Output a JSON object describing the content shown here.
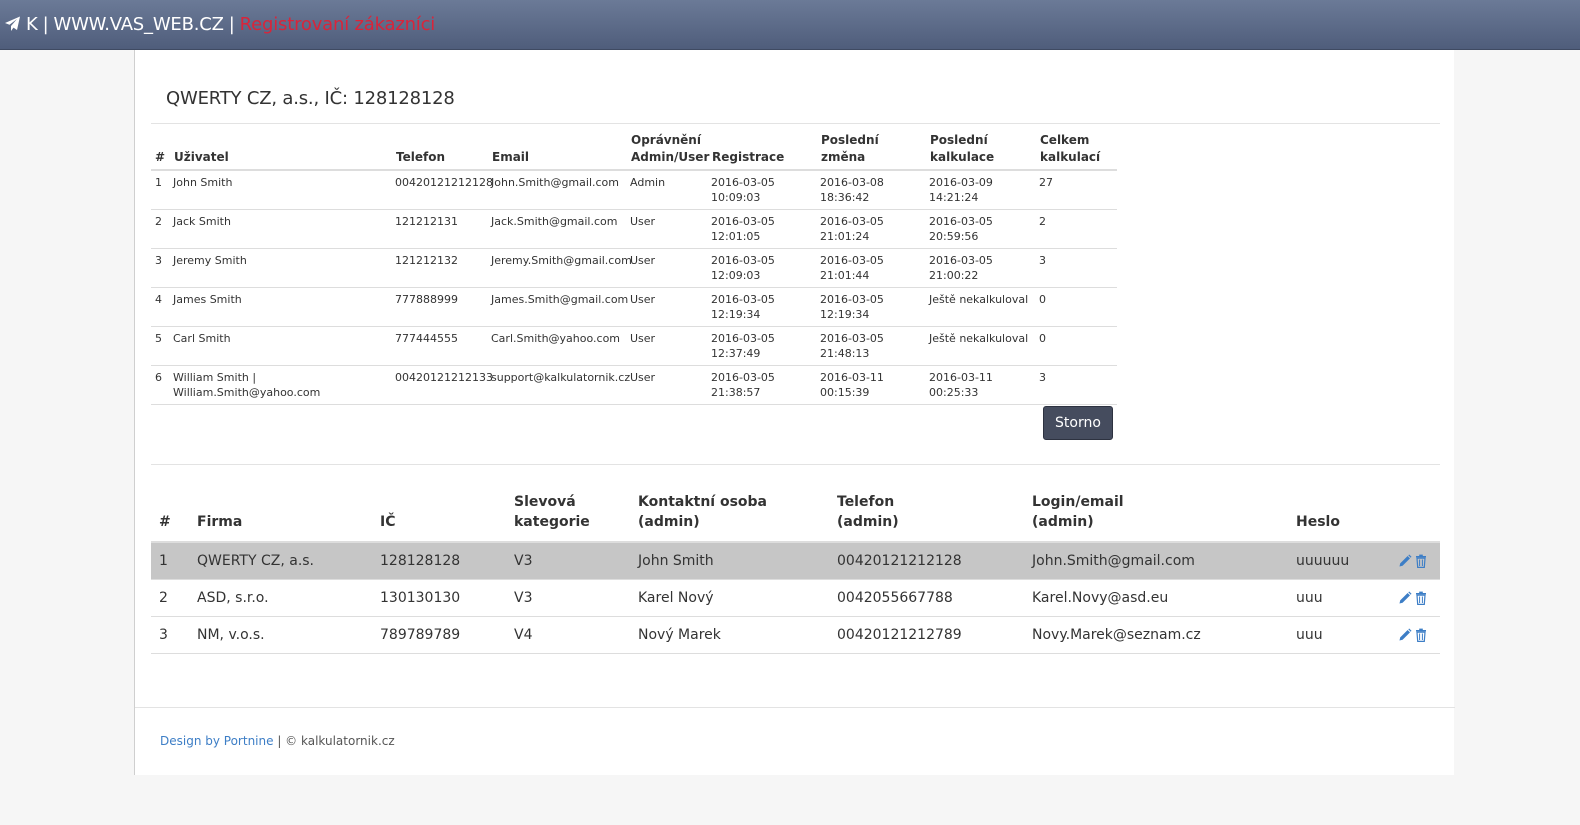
{
  "navbar": {
    "brand_k": "K",
    "sep": "|",
    "site": "WWW.VAS_WEB.CZ",
    "current_page": "Registrovaní zákazníci"
  },
  "company": {
    "title": "QWERTY CZ, a.s.,  IČ: 128128128"
  },
  "users_table": {
    "headers": {
      "num": "#",
      "user": "Uživatel",
      "phone": "Telefon",
      "email": "Email",
      "perm1": "Oprávnění",
      "perm2": "Admin/User",
      "reg": "Registrace",
      "change1": "Poslední",
      "change2": "změna",
      "calc1": "Poslední",
      "calc2": "kalkulace",
      "total1": "Celkem",
      "total2": "kalkulací"
    },
    "rows": [
      {
        "num": "1",
        "user": "John Smith",
        "user2": "",
        "phone": "00420121212128",
        "email": "John.Smith@gmail.com",
        "perm": "Admin",
        "reg_date": "2016-03-05",
        "reg_time": "10:09:03",
        "chg_date": "2016-03-08",
        "chg_time": "18:36:42",
        "calc_date": "2016-03-09",
        "calc_time": "14:21:24",
        "total": "27"
      },
      {
        "num": "2",
        "user": "Jack Smith",
        "user2": "",
        "phone": "121212131",
        "email": "Jack.Smith@gmail.com",
        "perm": "User",
        "reg_date": "2016-03-05",
        "reg_time": "12:01:05",
        "chg_date": "2016-03-05",
        "chg_time": "21:01:24",
        "calc_date": "2016-03-05",
        "calc_time": "20:59:56",
        "total": "2"
      },
      {
        "num": "3",
        "user": "Jeremy Smith",
        "user2": "",
        "phone": "121212132",
        "email": "Jeremy.Smith@gmail.com",
        "perm": "User",
        "reg_date": "2016-03-05",
        "reg_time": "12:09:03",
        "chg_date": "2016-03-05",
        "chg_time": "21:01:44",
        "calc_date": "2016-03-05",
        "calc_time": "21:00:22",
        "total": "3"
      },
      {
        "num": "4",
        "user": "James Smith",
        "user2": "",
        "phone": "777888999",
        "email": "James.Smith@gmail.com",
        "perm": "User",
        "reg_date": "2016-03-05",
        "reg_time": "12:19:34",
        "chg_date": "2016-03-05",
        "chg_time": "12:19:34",
        "calc_date": "Ještě nekalkuloval",
        "calc_time": "",
        "total": "0"
      },
      {
        "num": "5",
        "user": "Carl Smith",
        "user2": "",
        "phone": "777444555",
        "email": "Carl.Smith@yahoo.com",
        "perm": "User",
        "reg_date": "2016-03-05",
        "reg_time": "12:37:49",
        "chg_date": "2016-03-05",
        "chg_time": "21:48:13",
        "calc_date": "Ještě nekalkuloval",
        "calc_time": "",
        "total": "0"
      },
      {
        "num": "6",
        "user": "William Smith |",
        "user2": "William.Smith@yahoo.com",
        "phone": "00420121212133",
        "email": "support@kalkulatornik.cz",
        "perm": "User",
        "reg_date": "2016-03-05",
        "reg_time": "21:38:57",
        "chg_date": "2016-03-11",
        "chg_time": "00:15:39",
        "calc_date": "2016-03-11",
        "calc_time": "00:25:33",
        "total": "3"
      }
    ]
  },
  "storno_button": "Storno",
  "firms_table": {
    "headers": {
      "num": "#",
      "firm": "Firma",
      "ic": "IČ",
      "discount1": "Slevová",
      "discount2": "kategorie",
      "contact1": "Kontaktní osoba",
      "contact2": "(admin)",
      "phone1": "Telefon",
      "phone2": "(admin)",
      "login1": "Login/email",
      "login2": "(admin)",
      "password": "Heslo"
    },
    "rows": [
      {
        "num": "1",
        "firm": "QWERTY CZ, a.s.",
        "ic": "128128128",
        "discount": "V3",
        "contact": "John Smith",
        "phone": "00420121212128",
        "login": "John.Smith@gmail.com",
        "password": "uuuuuu",
        "active": true
      },
      {
        "num": "2",
        "firm": "ASD, s.r.o.",
        "ic": "130130130",
        "discount": "V3",
        "contact": "Karel Nový",
        "phone": "0042055667788",
        "login": "Karel.Novy@asd.eu",
        "password": "uuu",
        "active": false
      },
      {
        "num": "3",
        "firm": "NM, v.o.s.",
        "ic": "789789789",
        "discount": "V4",
        "contact": "Nový Marek",
        "phone": "00420121212789",
        "login": "Novy.Marek@seznam.cz",
        "password": "uuu",
        "active": false
      }
    ],
    "row_icons": [
      "pencil-icon",
      "trash-icon"
    ]
  },
  "footer": {
    "link": "Design by Portnine",
    "text": " | © kalkulatornik.cz"
  },
  "colors": {
    "navbar": "#5e6c8a",
    "accent_red": "#d9243a",
    "link_blue": "#3d7ec6",
    "active_row": "#c6c6c6",
    "button": "#454c5e"
  }
}
